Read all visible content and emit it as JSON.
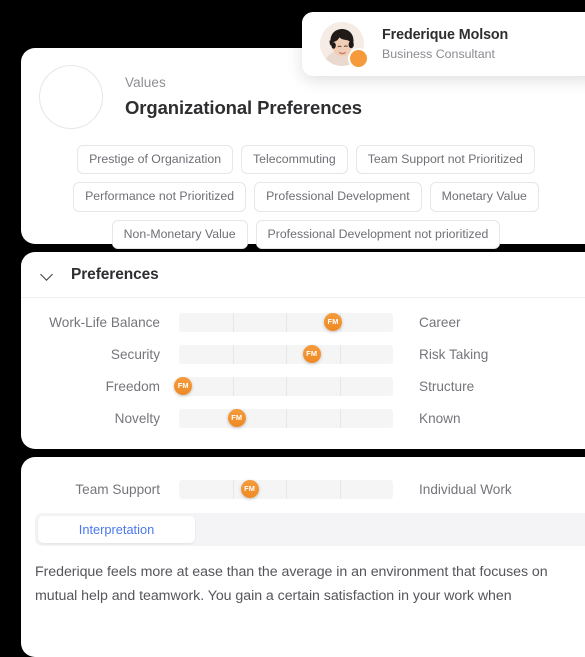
{
  "profile_popup": {
    "name": "Frederique Molson",
    "role": "Business Consultant",
    "avatar_icon": "user-photo",
    "badge_icon": "status-badge-icon"
  },
  "header": {
    "eyebrow": "Values",
    "title": "Organizational Preferences",
    "avatar_icon": "avatar-placeholder-icon"
  },
  "chips": [
    "Prestige of Organization",
    "Telecommuting",
    "Team Support not Prioritized",
    "Performance not Prioritized",
    "Professional Development",
    "Monetary Value",
    "Non-Monetary Value",
    "Professional Development not prioritized"
  ],
  "preferences_section": {
    "title": "Preferences",
    "collapse_icon": "chevron-down-icon",
    "segments": 4,
    "marker_initials": "FM",
    "rows": [
      {
        "left": "Work-Life Balance",
        "right": "Career",
        "position_pct": 72
      },
      {
        "left": "Security",
        "right": "Risk Taking",
        "position_pct": 62
      },
      {
        "left": "Freedom",
        "right": "Structure",
        "position_pct": 2
      },
      {
        "left": "Novelty",
        "right": "Known",
        "position_pct": 27
      }
    ]
  },
  "interpretation_section": {
    "rows": [
      {
        "left": "Team Support",
        "right": "Individual Work",
        "position_pct": 33
      }
    ],
    "marker_initials": "FM",
    "tabs": [
      {
        "label": "Interpretation",
        "active": true
      }
    ],
    "body": "Frederique feels more at ease than the average in an environment that focuses on mutual help and teamwork. You gain a certain satisfaction in your work when"
  },
  "colors": {
    "marker": "#F3922F",
    "tab_text": "#4A78F0",
    "track": "#F5F5F6",
    "background": "#000000"
  }
}
